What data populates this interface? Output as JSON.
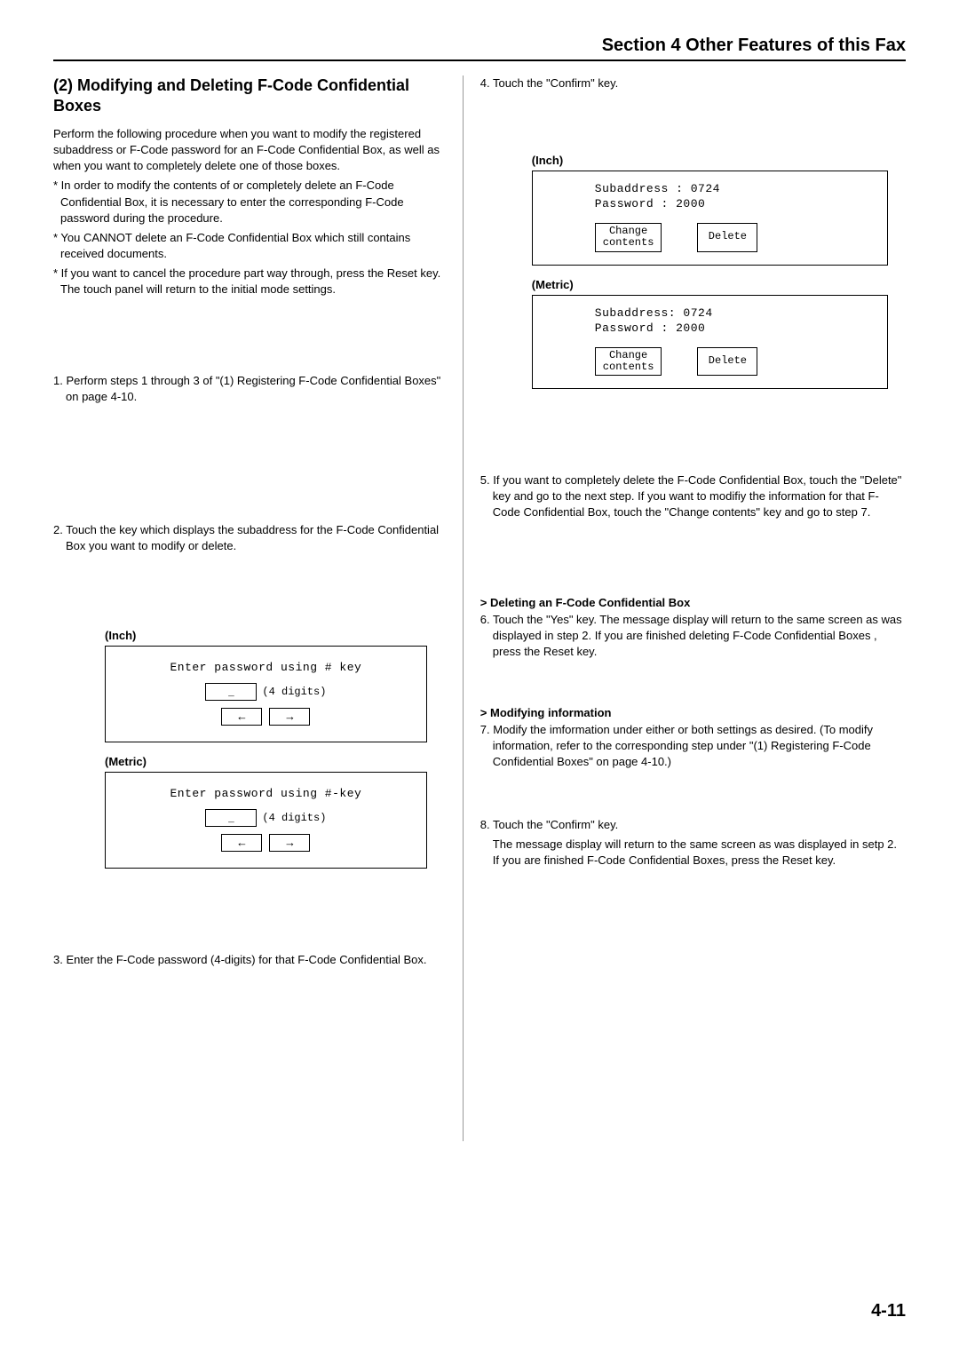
{
  "header": {
    "title": "Section 4 Other Features of this Fax"
  },
  "left": {
    "section_title": "(2) Modifying and Deleting F-Code Confidential Boxes",
    "intro": "Perform the following procedure when you want to modify the registered subaddress or F-Code password for an F-Code Confidential Box, as well as when you want to completely delete one of those boxes.",
    "star1": "* In order to modify the contents of or completely delete an F-Code Confidential Box, it is necessary to enter the corresponding F-Code password during the procedure.",
    "star2": "* You CANNOT delete an F-Code Confidential Box which still contains received documents.",
    "star3": "* If you want to cancel the procedure part way through, press the Reset key. The touch panel will return to the initial mode settings.",
    "step1": "1. Perform steps 1 through 3 of \"(1) Registering F-Code Confidential Boxes\" on page 4-10.",
    "step2": "2. Touch the key which displays the subaddress for the F-Code Confidential Box you want to modify or delete.",
    "inch_label": "(Inch)",
    "metric_label": "(Metric)",
    "inch_prompt": "Enter password using # key",
    "metric_prompt": "Enter password using #-key",
    "digits_hint": "(4 digits)",
    "underscore": "_",
    "step3": "3. Enter the F-Code password (4-digits) for that F-Code Confidential Box."
  },
  "right": {
    "step4": "4. Touch the \"Confirm\" key.",
    "inch_label": "(Inch)",
    "metric_label": "(Metric)",
    "sub_line_inch": "Subaddress : 0724",
    "pass_line_inch": "Password   : 2000",
    "sub_line_metric": "Subaddress: 0724",
    "pass_line_metric": "Password  : 2000",
    "change_btn": "Change contents",
    "change_btn_l1": "Change",
    "change_btn_l2": "contents",
    "delete_btn": "Delete",
    "step5": "5. If you want to completely delete the F-Code Confidential Box, touch the \"Delete\" key and go to the next step. If you want to modifiy the information for that F-Code Confidential Box, touch the \"Change contents\" key and go to step 7.",
    "del_head": "> Deleting an F-Code Confidential Box",
    "step6": "6. Touch the \"Yes\" key. The message display will return to the same screen as was displayed in step 2. If you are finished deleting F-Code Confidential Boxes , press the Reset key.",
    "mod_head": "> Modifying information",
    "step7": "7. Modify the imformation under either or both settings as desired. (To modify information, refer to the corresponding step under \"(1) Registering F-Code Confidential Boxes\" on page 4-10.)",
    "step8": "8. Touch the \"Confirm\" key.",
    "step8_cont": "The message display will return to the same screen as was displayed in setp 2. If you are finished F-Code Confidential Boxes, press the Reset key."
  },
  "page_num": "4-11"
}
